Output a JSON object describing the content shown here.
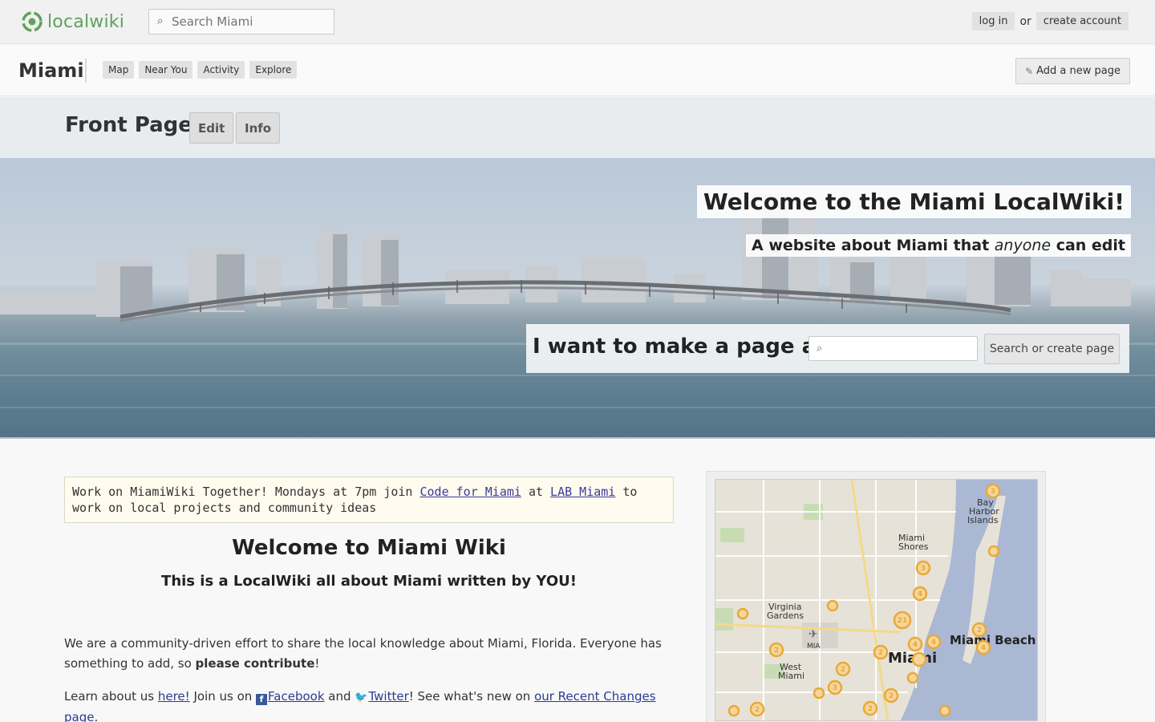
{
  "topbar": {
    "logo_text": "localwiki",
    "search_placeholder": "Search Miami",
    "login": "log in",
    "or": "or",
    "create_account": "create account"
  },
  "regionbar": {
    "region": "Miami",
    "nav": [
      "Map",
      "Near You",
      "Activity",
      "Explore"
    ],
    "add_page": "Add a new page"
  },
  "page": {
    "title": "Front Page",
    "edit": "Edit",
    "info": "Info"
  },
  "hero": {
    "title": "Welcome to the Miami LocalWiki!",
    "subtitle_pre": "A website about Miami that ",
    "subtitle_em": "anyone",
    "subtitle_post": " can edit",
    "form_label": "I want to make a page about",
    "form_button": "Search or create page"
  },
  "content": {
    "notice_pre": "Work on MiamiWiki Together! Mondays at 7pm join ",
    "notice_link1": "Code for Miami",
    "notice_mid": " at ",
    "notice_link2": "LAB Miami",
    "notice_post": " to work on local projects and community ideas",
    "welcome_title": "Welcome to Miami Wiki",
    "welcome_sub": "This is a LocalWiki all about Miami written by YOU!",
    "p1_pre": "We are a community-driven effort to share the local knowledge about Miami, Florida. Everyone has something to add, so ",
    "p1_bold": "please contribute",
    "p1_post": "!",
    "p2_pre": "Learn about us ",
    "p2_here": "here!",
    "p2_join": " Join us on ",
    "p2_facebook": "Facebook",
    "p2_and": " and ",
    "p2_twitter": "Twitter",
    "p2_see": "! See what's new on ",
    "p2_recent": "our Recent Changes page",
    "p2_end": "."
  },
  "map": {
    "labels": {
      "bay_harbor": [
        "Bay",
        "Harbor",
        "Islands"
      ],
      "miami_shores": [
        "Miami",
        "Shores"
      ],
      "virginia_gardens": [
        "Virginia",
        "Gardens"
      ],
      "mia": "MIA",
      "west_miami": [
        "West",
        "Miami"
      ],
      "miami": "Miami",
      "miami_beach": "Miami Beach"
    },
    "markers": [
      "3",
      "3",
      "4",
      "21",
      "4",
      "4",
      "2",
      "2",
      "2",
      "3",
      "2",
      "2",
      "2",
      "2"
    ]
  },
  "colors": {
    "accent_green": "#5fa25c",
    "link": "#2a3c8f",
    "marker": "#e8a93a"
  }
}
